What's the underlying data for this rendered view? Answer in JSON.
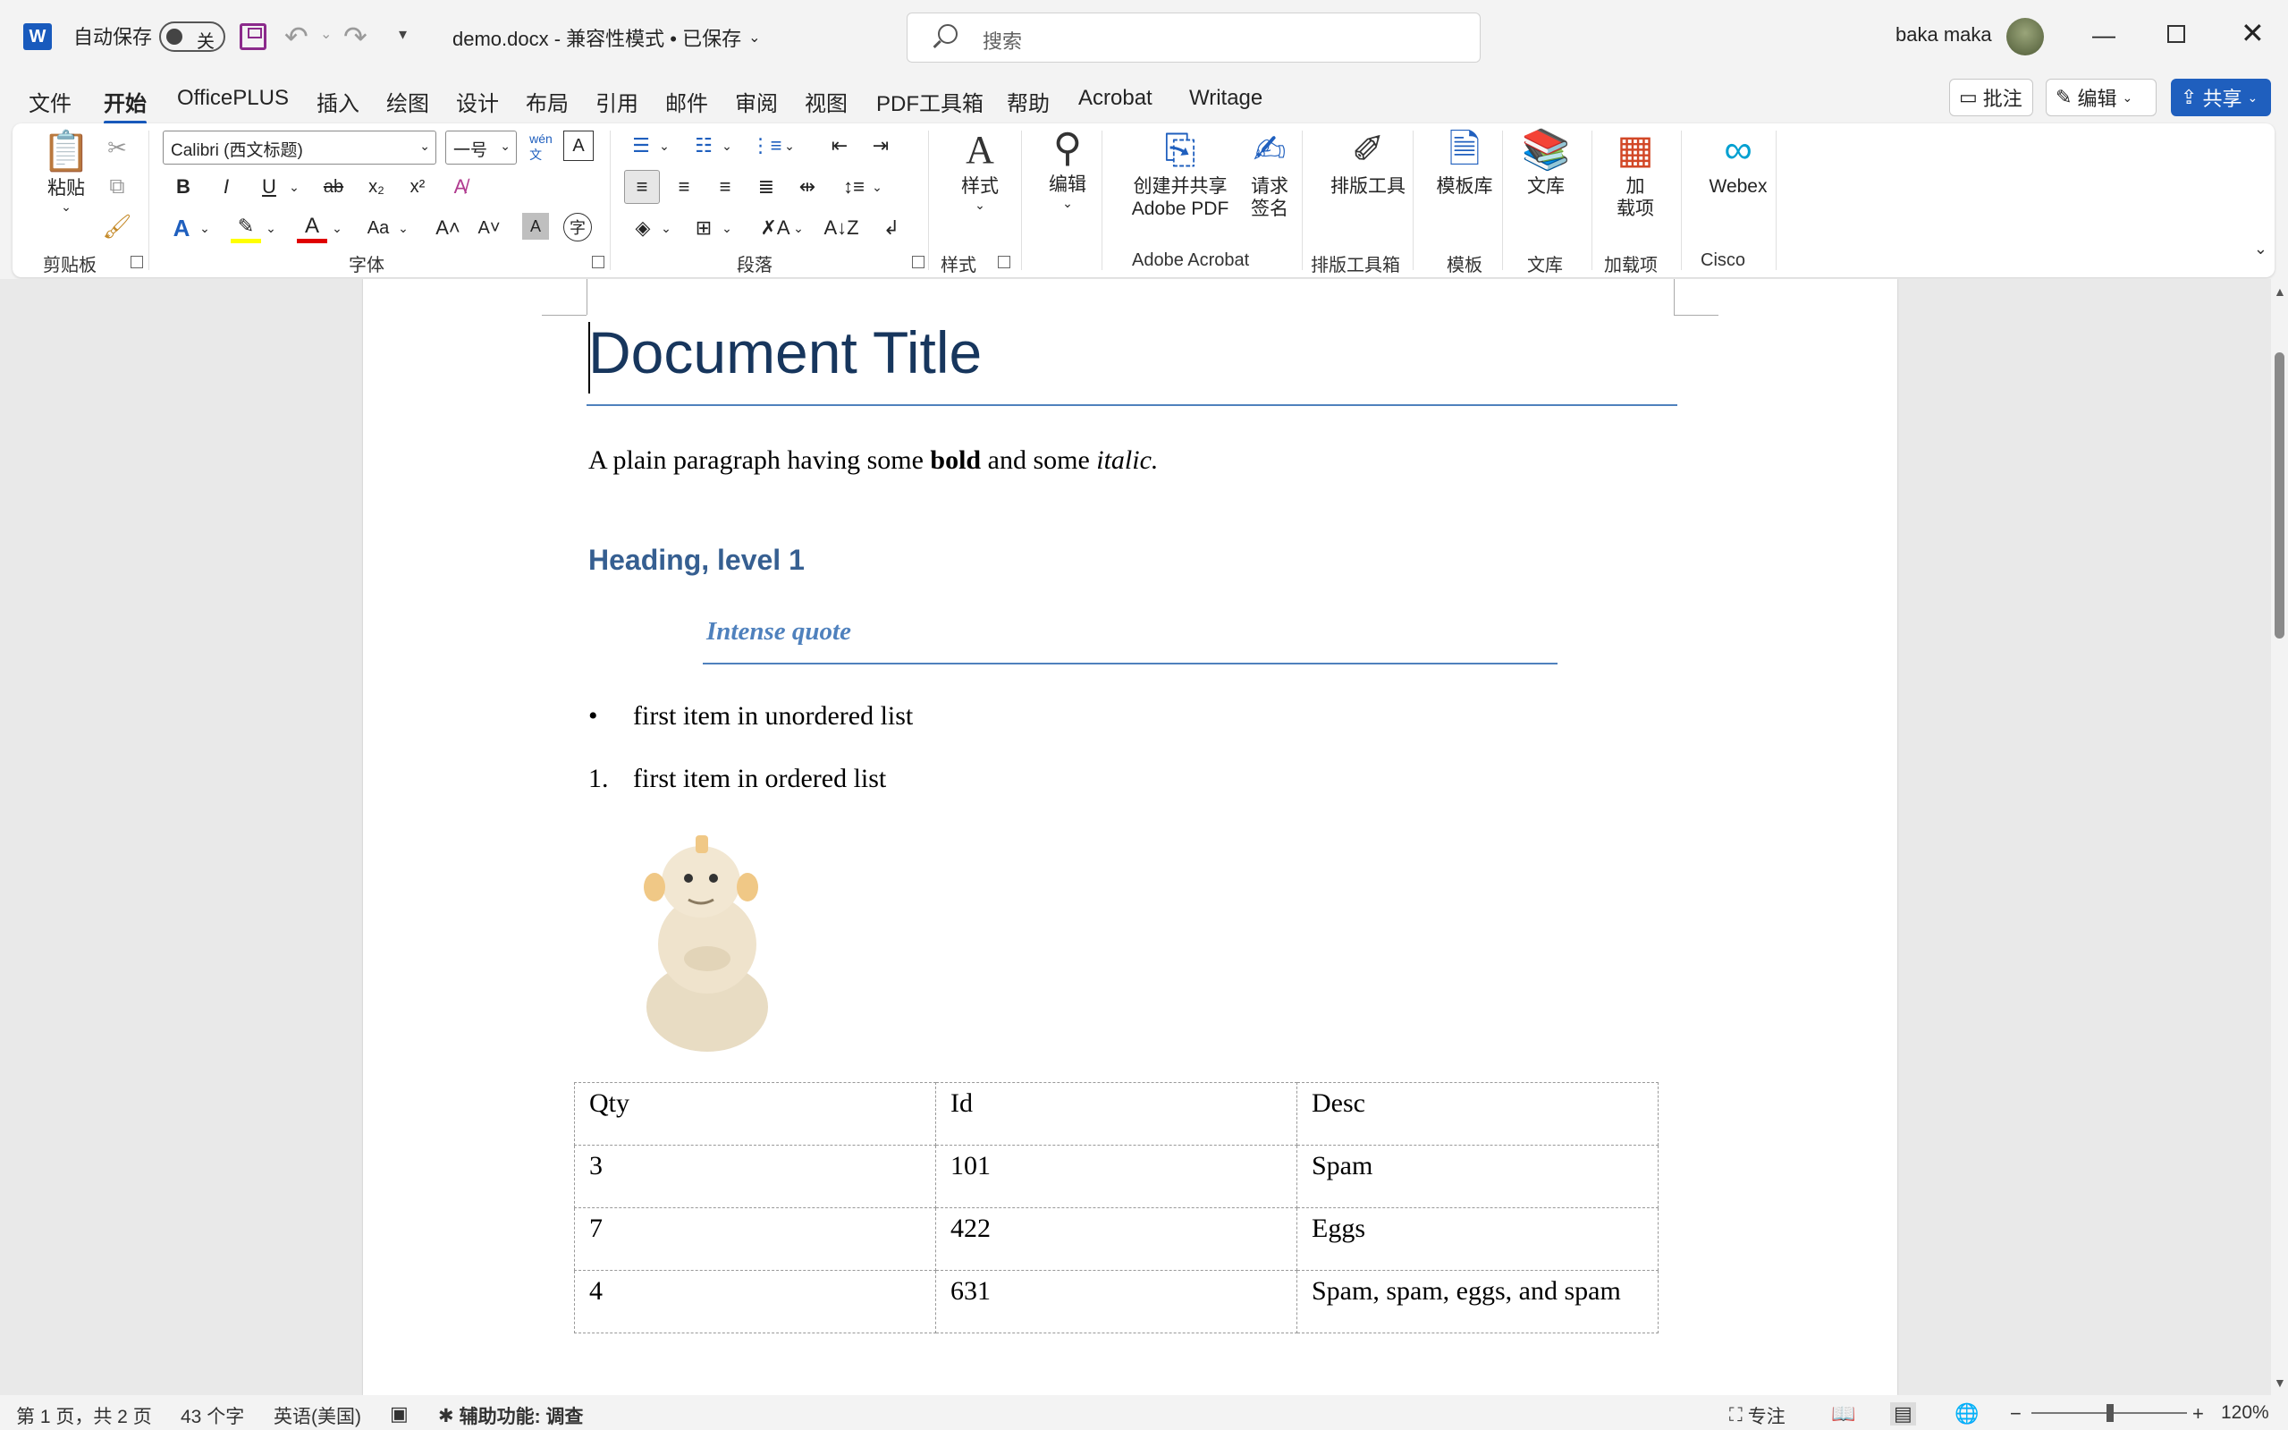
{
  "titlebar": {
    "app_logo": "W",
    "autosave_label": "自动保存",
    "autosave_state": "关",
    "doc_title": "demo.docx  -  兼容性模式 • 已保存",
    "search_placeholder": "搜索",
    "user_name": "baka maka"
  },
  "menu": {
    "tabs": [
      "文件",
      "开始",
      "OfficePLUS",
      "插入",
      "绘图",
      "设计",
      "布局",
      "引用",
      "邮件",
      "审阅",
      "视图",
      "PDF工具箱",
      "帮助",
      "Acrobat",
      "Writage"
    ],
    "active_tab": "开始",
    "comments_label": "批注",
    "edit_label": "编辑",
    "share_label": "共享"
  },
  "ribbon": {
    "paste_label": "粘贴",
    "font_name": "Calibri (西文标题)",
    "font_size": "一号",
    "styles_label": "样式",
    "editing_label": "编辑",
    "create_share_pdf": "创建并共享\nAdobe PDF",
    "request_sign": "请求\n签名",
    "layout_tool": "排版工具",
    "templates": "模板库",
    "library": "文库",
    "addins": "加\n载项",
    "webex": "Webex",
    "groups": {
      "clipboard": "剪贴板",
      "font": "字体",
      "paragraph": "段落",
      "styles": "样式",
      "adobe": "Adobe Acrobat",
      "layout": "排版工具箱",
      "template": "模板",
      "library": "文库",
      "addins": "加载项",
      "cisco": "Cisco"
    }
  },
  "document": {
    "title": "Document Title",
    "para_prefix": "A plain paragraph having some ",
    "para_bold": "bold",
    "para_mid": " and some ",
    "para_italic": "italic.",
    "heading1": "Heading, level 1",
    "intense_quote": "Intense quote",
    "bullet_item": "first item in unordered list",
    "bullet_marker": "•",
    "ordered_marker": "1.",
    "ordered_item": "first item in ordered list",
    "table": {
      "headers": [
        "Qty",
        "Id",
        "Desc"
      ],
      "rows": [
        [
          "3",
          "101",
          "Spam"
        ],
        [
          "7",
          "422",
          "Eggs"
        ],
        [
          "4",
          "631",
          "Spam, spam, eggs, and spam"
        ]
      ]
    }
  },
  "statusbar": {
    "page_info": "第 1 页，共 2 页",
    "word_count": "43 个字",
    "language": "英语(美国)",
    "accessibility": "辅助功能: 调查",
    "focus": "专注",
    "zoom": "120%"
  },
  "colors": {
    "accent": "#185abd",
    "title_text": "#17365d",
    "heading_text": "#365f91",
    "quote_text": "#4f81bd"
  }
}
